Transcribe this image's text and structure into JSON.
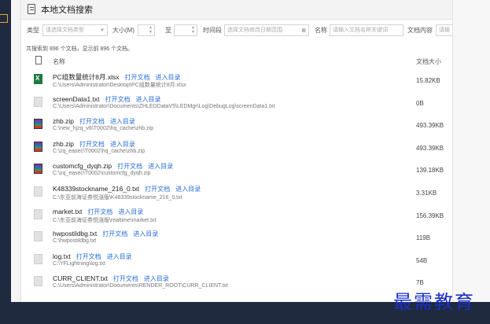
{
  "title": "本地文档搜索",
  "filters": {
    "type_label": "类型",
    "type_placeholder": "请选择文档类型",
    "size_label": "大小(M)",
    "to_label": "至",
    "time_label": "时间段",
    "time_placeholder": "选择文档修改日期范围",
    "name_label": "名称",
    "name_placeholder": "请输入文档名称关键词",
    "content_label": "文档内容",
    "content_placeholder": "请输"
  },
  "summary": "共搜索到 896 个文档，显示前 896 个文档。",
  "columns": {
    "name": "名称",
    "size": "文档大小"
  },
  "actions": {
    "open": "打开文档",
    "enter": "进入目录"
  },
  "rows": [
    {
      "icon": "xlsx-file-icon",
      "name": "PC组数量统计8月.xlsx",
      "path": "C:\\Users\\Administrator\\Desktop\\PC组数量统计8月.xlsx",
      "size": "15.82KB"
    },
    {
      "icon": "txt-file-icon",
      "name": "screenData1.txt",
      "path": "C:\\Users\\Administrator\\Documents\\ZHLEDDataV5\\LEDMgr\\Log\\DebugLog\\screenData1.txt",
      "size": "0B"
    },
    {
      "icon": "zip-file-icon",
      "name": "zhb.zip",
      "path": "C:\\new_hjzq_v6\\T0002\\hq_cache\\zhb.zip",
      "size": "493.39KB"
    },
    {
      "icon": "zip-file-icon",
      "name": "zhb.zip",
      "path": "C:\\zq_easec\\T0002\\hq_cache\\zhb.zip",
      "size": "493.39KB"
    },
    {
      "icon": "zip-file-icon",
      "name": "customcfg_dyqh.zip",
      "path": "C:\\zq_easec\\T0002\\customcfg_dyqh.zip",
      "size": "139.18KB"
    },
    {
      "icon": "txt-file-icon",
      "name": "K48339stockname_216_0.txt",
      "path": "C:\\东亚前海证券悦涨版\\K48339stockname_216_0.txt",
      "size": "3.31KB"
    },
    {
      "icon": "txt-file-icon",
      "name": "market.txt",
      "path": "C:\\东亚前海证券悦涨版\\realtime\\market.txt",
      "size": "156.39KB"
    },
    {
      "icon": "txt-file-icon",
      "name": "hwpostildbg.txt",
      "path": "C:\\hwpostildbg.txt",
      "size": "119B"
    },
    {
      "icon": "txt-file-icon",
      "name": "log.txt",
      "path": "C:\\YFLightning\\log.txt",
      "size": "54B"
    },
    {
      "icon": "txt-file-icon",
      "name": "CURR_CLIENT.txt",
      "path": "C:\\Users\\Administrator\\Documents\\RENDER_ROOT\\CURR_CLIENT.txt",
      "size": "7B"
    }
  ],
  "watermark": "最需教育"
}
